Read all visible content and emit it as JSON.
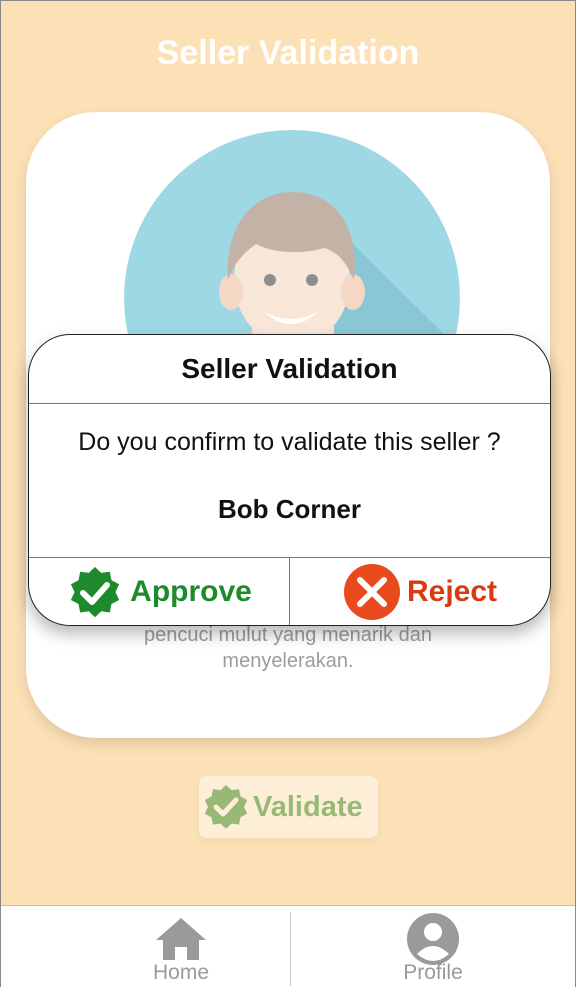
{
  "header": {
    "title": "Seller Validation"
  },
  "card": {
    "description_line1": "pencuci mulut yang menarik dan",
    "description_line2": "menyelerakan."
  },
  "validate_button": {
    "label": "Validate"
  },
  "dialog": {
    "title": "Seller Validation",
    "message": "Do you confirm to validate this seller ?",
    "seller_name": "Bob Corner",
    "approve_label": "Approve",
    "reject_label": "Reject"
  },
  "bottom_nav": {
    "items": [
      {
        "label": "Home",
        "icon": "home-icon"
      },
      {
        "label": "Profile",
        "icon": "profile-icon"
      }
    ]
  },
  "colors": {
    "background": "#fde1b6",
    "approve": "#1d8a2c",
    "reject": "#e8491d",
    "avatar_bg": "#9dd8e4"
  }
}
